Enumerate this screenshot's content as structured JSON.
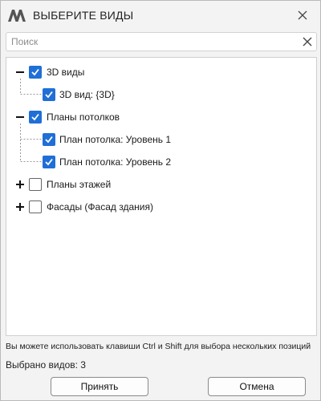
{
  "window": {
    "title": "ВЫБЕРИТЕ ВИДЫ",
    "icons": {
      "logo": "app-logo-icon",
      "close": "close-icon"
    }
  },
  "search": {
    "placeholder": "Поиск",
    "value": "",
    "clear_icon": "clear-x-icon"
  },
  "tree": {
    "groups": [
      {
        "label": "3D виды",
        "checked": true,
        "expanded": true,
        "children": [
          {
            "label": "3D вид: {3D}",
            "checked": true
          }
        ]
      },
      {
        "label": "Планы потолков",
        "checked": true,
        "expanded": true,
        "children": [
          {
            "label": "План потолка: Уровень 1",
            "checked": true
          },
          {
            "label": "План потолка: Уровень 2",
            "checked": true
          }
        ]
      },
      {
        "label": "Планы этажей",
        "checked": false,
        "expanded": false,
        "children": []
      },
      {
        "label": "Фасады (Фасад здания)",
        "checked": false,
        "expanded": false,
        "children": []
      }
    ]
  },
  "footer": {
    "hint": "Вы можете использовать клавиши Ctrl и Shift для выбора нескольких позиций",
    "count_text": "Выбрано видов: 3",
    "accept_label": "Принять",
    "cancel_label": "Отмена"
  },
  "colors": {
    "accent": "#1f6fd6",
    "background": "#f3f3f3",
    "panel": "#ffffff"
  }
}
